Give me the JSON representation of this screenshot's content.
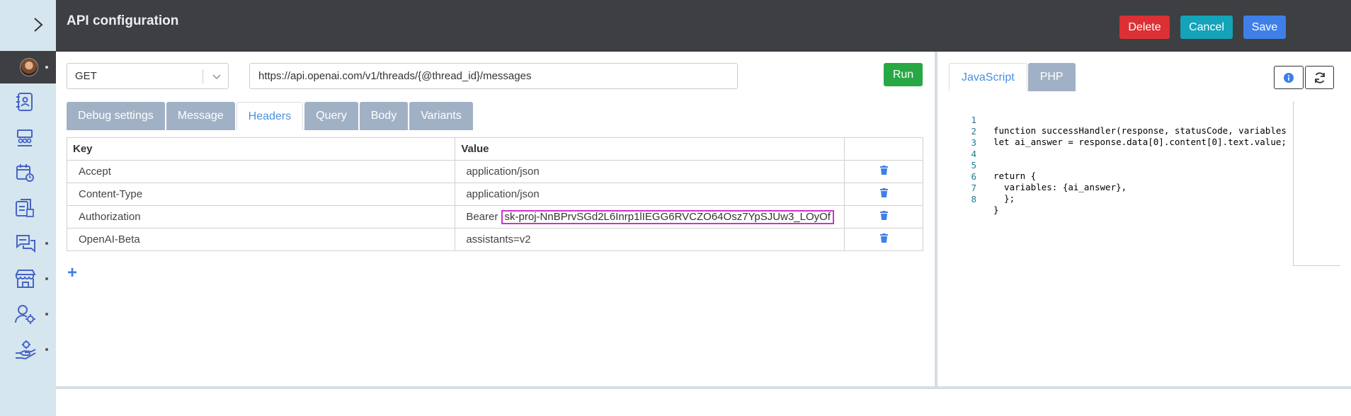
{
  "header": {
    "title": "API configuration",
    "delete_label": "Delete",
    "cancel_label": "Cancel",
    "save_label": "Save"
  },
  "request": {
    "method": "GET",
    "url": "https://api.openai.com/v1/threads/{@thread_id}/messages",
    "run_label": "Run"
  },
  "tabs": [
    "Debug settings",
    "Message",
    "Headers",
    "Query",
    "Body",
    "Variants"
  ],
  "active_tab": "Headers",
  "headers_table": {
    "columns": [
      "Key",
      "Value"
    ],
    "rows": [
      {
        "key": "Accept",
        "value": "application/json"
      },
      {
        "key": "Content-Type",
        "value": "application/json"
      },
      {
        "key": "Authorization",
        "value_prefix": "Bearer",
        "value_token": "sk-proj-NnBPrvSGd2L6Inrp1lIEGG6RVCZO64Osz7YpSJUw3_LOyOf"
      },
      {
        "key": "OpenAI-Beta",
        "value": "assistants=v2"
      }
    ],
    "add_label": "+"
  },
  "code_tabs": [
    "JavaScript",
    "PHP"
  ],
  "active_code_tab": "JavaScript",
  "code_lines": [
    {
      "n": "1",
      "text": "function successHandler(response, statusCode, variables"
    },
    {
      "n": "2",
      "text": "let ai_answer = response.data[0].content[0].text.value;"
    },
    {
      "n": "3",
      "text": ""
    },
    {
      "n": "4",
      "text": ""
    },
    {
      "n": "5",
      "text": "return {"
    },
    {
      "n": "6",
      "text": "  variables: {ai_answer},"
    },
    {
      "n": "7",
      "text": "  };"
    },
    {
      "n": "8",
      "text": "}"
    }
  ],
  "colors": {
    "header_bg": "#3d3f42",
    "sidebar_bg": "#d5e6ee",
    "delete": "#dc3035",
    "cancel": "#14a3b8",
    "save": "#3f7fe8",
    "run": "#28a745",
    "tab_inactive": "#a1b1c5",
    "accent": "#4a90e2"
  },
  "icons": [
    "chevron-right-icon",
    "contacts-icon",
    "team-icon",
    "calendar-icon",
    "documents-icon",
    "chat-icon",
    "store-icon",
    "user-settings-icon",
    "hand-gear-icon",
    "trash-icon",
    "info-icon",
    "refresh-icon",
    "chevron-down-icon"
  ]
}
